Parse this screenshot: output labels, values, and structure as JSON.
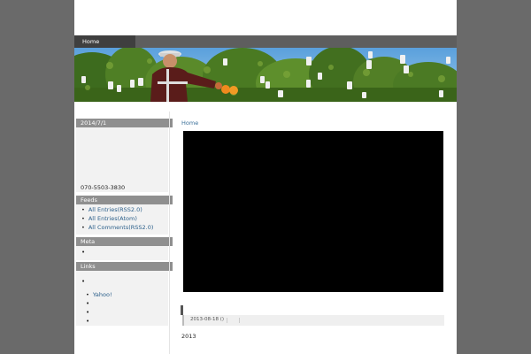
{
  "nav": {
    "home_label": "Home"
  },
  "sidebar": {
    "date_title": "2014/7/1",
    "phone": "070-5503-3830",
    "feeds_title": "Feeds",
    "feeds": [
      "All Entries(RSS2.0)",
      "All Entries(Atom)",
      "All Comments(RSS2.0)"
    ],
    "meta_title": "Meta",
    "links_title": "Links",
    "links": [
      "Yahoo!"
    ]
  },
  "main": {
    "breadcrumb": "Home",
    "post_date": "2013-08-18 ()",
    "post_body": "2013"
  },
  "colors": {
    "background": "#6a6a6a",
    "nav_bar": "#5e5e5e",
    "nav_active": "#3f3f3f",
    "widget_title": "#8f8f8f",
    "link": "#2b5f8a",
    "video": "#000000"
  }
}
